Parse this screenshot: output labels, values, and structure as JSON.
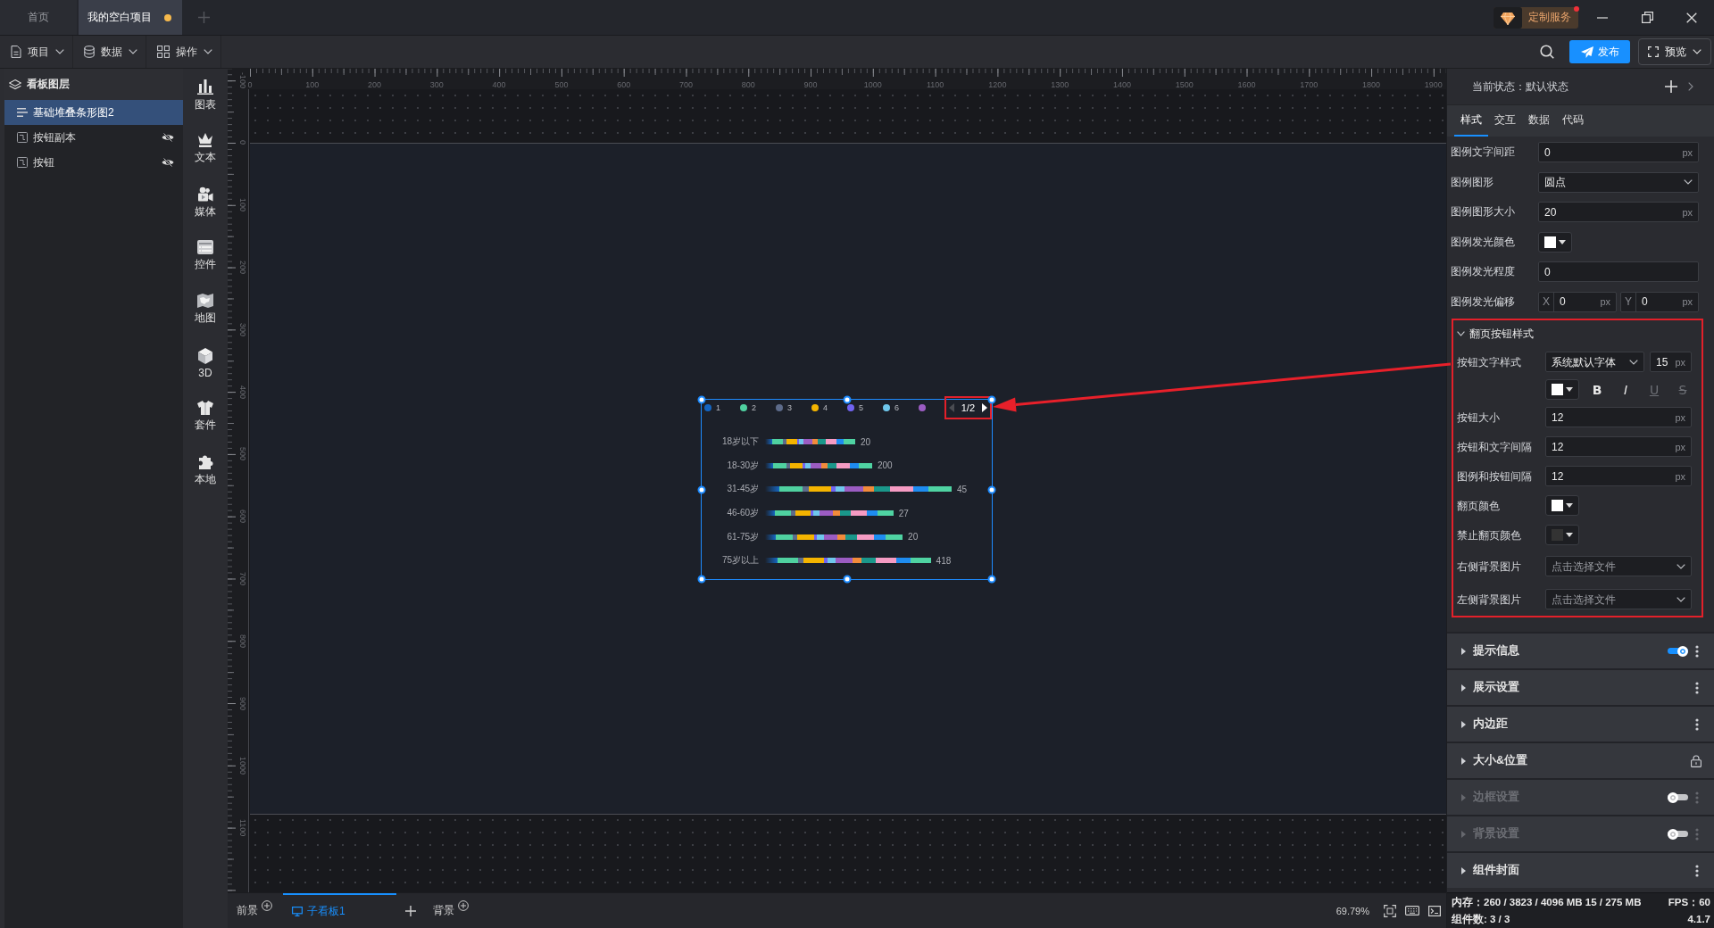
{
  "title_bar": {
    "tabs": [
      {
        "label": "首页",
        "selected": false,
        "unsaved": false
      },
      {
        "label": "我的空白项目",
        "selected": true,
        "unsaved": true
      }
    ],
    "service_badge": {
      "label": "定制服务",
      "notification": true
    }
  },
  "toolbar": {
    "menus": [
      "项目",
      "数据",
      "操作"
    ],
    "publish": "发布",
    "preview": "预览"
  },
  "layers_panel": {
    "title": "看板图层",
    "items": [
      {
        "label": "基础堆叠条形图2",
        "kind": "chart",
        "selected": true,
        "hidden": false
      },
      {
        "label": "按钮副本",
        "kind": "button",
        "selected": false,
        "hidden": true
      },
      {
        "label": "按钮",
        "kind": "button",
        "selected": false,
        "hidden": true
      }
    ]
  },
  "tools": [
    "图表",
    "文本",
    "媒体",
    "控件",
    "地图",
    "3D",
    "套件",
    "本地"
  ],
  "rulers": {
    "horizontal": [
      "0",
      "100",
      "200",
      "300",
      "400",
      "500",
      "600",
      "700",
      "800",
      "900",
      "1000",
      "1100",
      "1200",
      "1300",
      "1400",
      "1500",
      "1600",
      "1700",
      "1800",
      "1900"
    ],
    "vertical": [
      "-100",
      "0",
      "100",
      "200",
      "300",
      "400",
      "500",
      "600",
      "700",
      "800",
      "900",
      "1000",
      "1100"
    ]
  },
  "chart": {
    "selected": true,
    "legend": [
      {
        "label": "1",
        "color": "#1565c0"
      },
      {
        "label": "2",
        "color": "#4fd1a0"
      },
      {
        "label": "3",
        "color": "#5d6b8a"
      },
      {
        "label": "4",
        "color": "#f4b400"
      },
      {
        "label": "5",
        "color": "#7163f1"
      },
      {
        "label": "6",
        "color": "#6fc7ec"
      },
      {
        "color": "#9b5cc2"
      }
    ],
    "pager": {
      "text": "1/2",
      "prev_disabled": true,
      "next_disabled": false,
      "highlighted": true
    },
    "rows": [
      {
        "category": "18岁以下",
        "total": "20"
      },
      {
        "category": "18-30岁",
        "total": "200"
      },
      {
        "category": "31-45岁",
        "total": "45"
      },
      {
        "category": "46-60岁",
        "total": "27"
      },
      {
        "category": "61-75岁",
        "total": "20"
      },
      {
        "category": "75岁以上",
        "total": "418"
      }
    ]
  },
  "callout_arrow": true,
  "bottom_bar": {
    "foreground": "前景",
    "boards": [
      {
        "label": "子看板1",
        "selected": true
      }
    ],
    "background": "背景",
    "zoom": "69.79%"
  },
  "properties_panel": {
    "state": "当前状态：默认状态",
    "tabs": [
      {
        "label": "样式",
        "selected": true
      },
      {
        "label": "交互",
        "selected": false
      },
      {
        "label": "数据",
        "selected": false
      },
      {
        "label": "代码",
        "selected": false
      }
    ],
    "fields": [
      {
        "kind": "number",
        "label": "图例文字间距",
        "value": "0",
        "unit": "px"
      },
      {
        "kind": "select",
        "label": "图例图形",
        "value": "圆点"
      },
      {
        "kind": "number",
        "label": "图例图形大小",
        "value": "20",
        "unit": "px"
      },
      {
        "kind": "color",
        "label": "图例发光颜色",
        "color": "#ffffff"
      },
      {
        "kind": "number",
        "label": "图例发光程度",
        "value": "0"
      },
      {
        "kind": "offset",
        "label": "图例发光偏移",
        "parts": [
          {
            "axis": "X",
            "value": "0",
            "unit": "px"
          },
          {
            "axis": "Y",
            "value": "0",
            "unit": "px"
          }
        ]
      }
    ],
    "pager_section": {
      "title": "翻页按钮样式",
      "expanded": true,
      "highlighted": true,
      "fields": [
        {
          "kind": "font",
          "label": "按钮文字样式",
          "font": "系统默认字体",
          "size": "15",
          "unit": "px",
          "color": "#ffffff",
          "styles": [
            {
              "label": "B",
              "kind": "bold",
              "disabled": false
            },
            {
              "label": "I",
              "kind": "italic",
              "disabled": false
            },
            {
              "label": "U",
              "kind": "underline",
              "disabled": true
            },
            {
              "label": "S",
              "kind": "strike",
              "disabled": true
            }
          ]
        },
        {
          "kind": "number",
          "label": "按钮大小",
          "value": "12",
          "unit": "px"
        },
        {
          "kind": "number",
          "label": "按钮和文字间隔",
          "value": "12",
          "unit": "px"
        },
        {
          "kind": "number",
          "label": "图例和按钮间隔",
          "value": "12",
          "unit": "px"
        },
        {
          "kind": "color",
          "label": "翻页颜色",
          "color": "#ffffff"
        },
        {
          "kind": "color",
          "label": "禁止翻页颜色",
          "color": "#333333"
        },
        {
          "kind": "select",
          "label": "右侧背景图片",
          "placeholder": "点击选择文件"
        },
        {
          "kind": "select",
          "label": "左侧背景图片",
          "placeholder": "点击选择文件"
        }
      ]
    },
    "sections": [
      {
        "title": "提示信息",
        "kind": "switch",
        "on": true,
        "expanded": false,
        "disabled": false
      },
      {
        "title": "展示设置",
        "kind": "menu",
        "expanded": false,
        "disabled": false
      },
      {
        "title": "内边距",
        "kind": "menu",
        "expanded": false,
        "disabled": false
      },
      {
        "title": "大小&位置",
        "kind": "locked",
        "expanded": false,
        "disabled": false
      },
      {
        "title": "边框设置",
        "kind": "switch",
        "on": false,
        "expanded": false,
        "disabled": true
      },
      {
        "title": "背景设置",
        "kind": "switch",
        "on": false,
        "expanded": false,
        "disabled": true
      },
      {
        "title": "组件封面",
        "kind": "menu",
        "expanded": false,
        "disabled": false
      }
    ]
  },
  "status_bar": {
    "memory": "内存：260 / 3823 / 4096 MB 15 / 275 MB",
    "fps": "FPS：60",
    "components": "组件数: 3 / 3",
    "version": "4.1.7"
  }
}
